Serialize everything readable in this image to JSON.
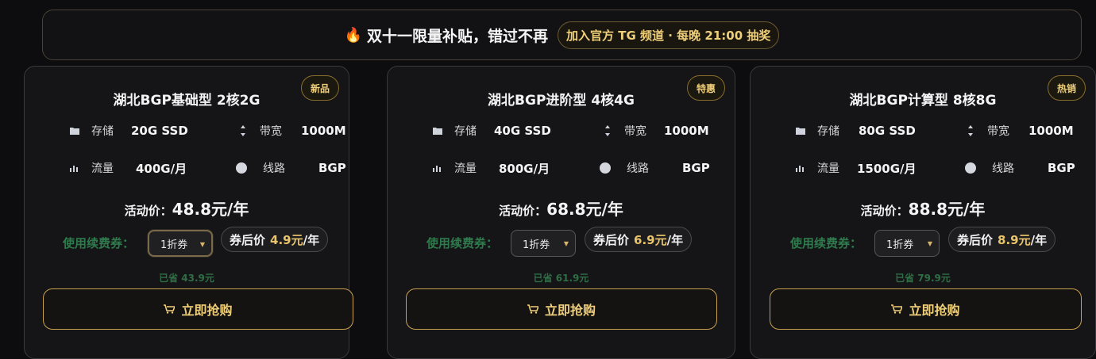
{
  "banner": {
    "fire_icon": "🔥",
    "title": "双十一限量补贴，错过不再",
    "pill": "加入官方 TG 频道 · 每晚 21:00 抽奖"
  },
  "colors": {
    "accent_gold": "#f0cf7a",
    "coupon_green": "#2f7a4c",
    "background": "#0d0d0f"
  },
  "cards": [
    {
      "badge": "新品",
      "title": "湖北BGP基础型 2核2G",
      "storage_label": "存储",
      "storage_value": "20G SSD",
      "bandwidth_label": "带宽",
      "bandwidth_value": "1000M",
      "traffic_label": "流量",
      "traffic_value": "400G/月",
      "line_label": "线路",
      "line_value": "BGP",
      "price_label": "活动价：",
      "price_value": "48.8元/年",
      "coupon_label": "使用续费券：",
      "coupon_selected": "1折券",
      "after_label": "券后价",
      "after_value": "4.9元",
      "after_unit": "/年",
      "saved": "已省 43.9元",
      "buy_label": "立即抢购"
    },
    {
      "badge": "特惠",
      "title": "湖北BGP进阶型 4核4G",
      "storage_label": "存储",
      "storage_value": "40G SSD",
      "bandwidth_label": "带宽",
      "bandwidth_value": "1000M",
      "traffic_label": "流量",
      "traffic_value": "800G/月",
      "line_label": "线路",
      "line_value": "BGP",
      "price_label": "活动价：",
      "price_value": "68.8元/年",
      "coupon_label": "使用续费券：",
      "coupon_selected": "1折券",
      "after_label": "券后价",
      "after_value": "6.9元",
      "after_unit": "/年",
      "saved": "已省 61.9元",
      "buy_label": "立即抢购"
    },
    {
      "badge": "热销",
      "title": "湖北BGP计算型 8核8G",
      "storage_label": "存储",
      "storage_value": "80G SSD",
      "bandwidth_label": "带宽",
      "bandwidth_value": "1000M",
      "traffic_label": "流量",
      "traffic_value": "1500G/月",
      "line_label": "线路",
      "line_value": "BGP",
      "price_label": "活动价：",
      "price_value": "88.8元/年",
      "coupon_label": "使用续费券：",
      "coupon_selected": "1折券",
      "after_label": "券后价",
      "after_value": "8.9元",
      "after_unit": "/年",
      "saved": "已省 79.9元",
      "buy_label": "立即抢购"
    }
  ]
}
